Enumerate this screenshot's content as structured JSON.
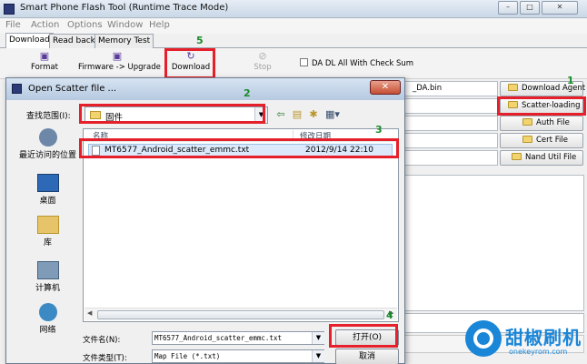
{
  "main_window": {
    "title": "Smart Phone Flash Tool (Runtime Trace Mode)",
    "menu": [
      "File",
      "Action",
      "Options",
      "Window",
      "Help"
    ],
    "tabs": [
      "Download",
      "Read back",
      "Memory Test"
    ],
    "toolbar": {
      "format": "Format",
      "firmware_upgrade": "Firmware -> Upgrade",
      "download": "Download",
      "stop": "Stop",
      "da_checkbox": "DA DL All With Check Sum"
    },
    "side_buttons": [
      "Download Agent",
      "Scatter-loading",
      "Auth File",
      "Cert File",
      "Nand Util File"
    ],
    "da_field": "_DA.bin"
  },
  "steps": {
    "s1": "1",
    "s2": "2",
    "s3": "3",
    "s4": "4",
    "s5": "5"
  },
  "dialog": {
    "title": "Open Scatter file ...",
    "look_in_label": "查找范围(I):",
    "look_in_value": "固件",
    "places": [
      "最近访问的位置",
      "桌面",
      "库",
      "计算机",
      "网络"
    ],
    "columns": {
      "name": "名称",
      "modified": "修改日期"
    },
    "files": [
      {
        "name": "MT6577_Android_scatter_emmc.txt",
        "modified": "2012/9/14 22:10"
      }
    ],
    "filename_label": "文件名(N):",
    "filename_value": "MT6577_Android_scatter_emmc.txt",
    "filetype_label": "文件类型(T):",
    "filetype_value": "Map File (*.txt)",
    "open_button": "打开(O)",
    "cancel_button": "取消"
  },
  "watermark": {
    "text": "甜椒刷机",
    "sub": "onekeyrom.com"
  }
}
